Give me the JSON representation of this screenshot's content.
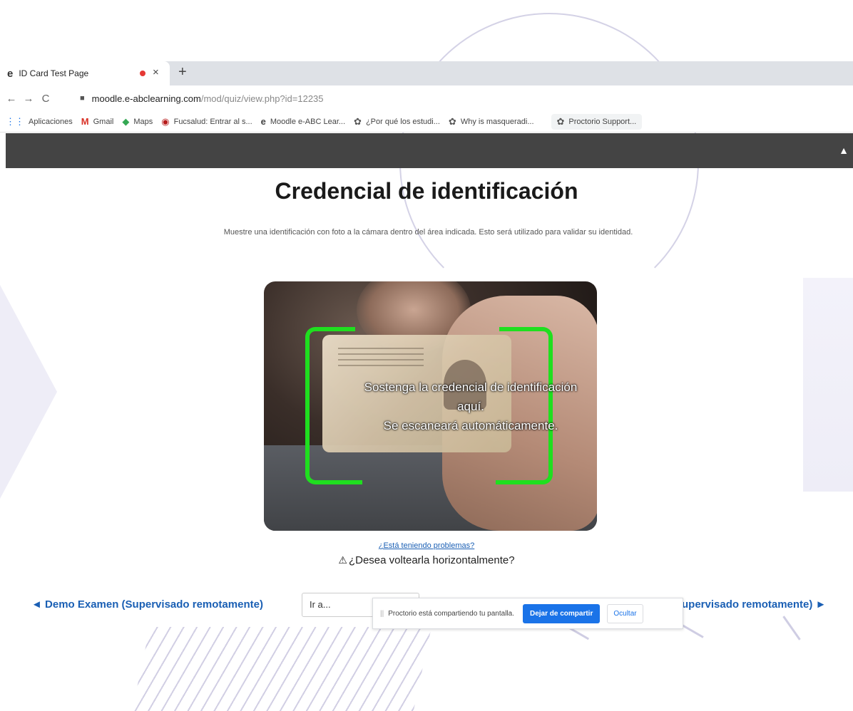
{
  "browser": {
    "tab_title": "ID Card Test Page",
    "tab_icon": "e",
    "close_glyph": "×",
    "new_tab_glyph": "+",
    "back_glyph": "←",
    "forward_glyph": "→",
    "reload_glyph": "C",
    "url_host": "moodle.e-abclearning.com",
    "url_path": "/mod/quiz/view.php?id=12235",
    "bookmarks": [
      {
        "icon": "apps-grid-icon",
        "glyph": "⋮⋮",
        "label": "Aplicaciones"
      },
      {
        "icon": "gmail-icon",
        "glyph": "M",
        "label": "Gmail"
      },
      {
        "icon": "maps-icon",
        "glyph": "◆",
        "label": "Maps"
      },
      {
        "icon": "fucsalud-icon",
        "glyph": "◉",
        "label": "Fucsalud: Entrar al s..."
      },
      {
        "icon": "moodle-icon",
        "glyph": "e",
        "label": "Moodle e-ABC Lear..."
      },
      {
        "icon": "proctorio-icon",
        "glyph": "✿",
        "label": "¿Por qué los estudi..."
      },
      {
        "icon": "proctorio-icon",
        "glyph": "✿",
        "label": "Why is masqueradi..."
      },
      {
        "icon": "proctorio-icon",
        "glyph": "✿",
        "label": "Proctorio Support..."
      }
    ]
  },
  "page": {
    "title": "Credencial de identificación",
    "instructions": "Muestre una identificación con foto a la cámara dentro del área indicada. Esto será utilizado para validar su identidad.",
    "camera_overlay_line1": "Sostenga la credencial de identificación",
    "camera_overlay_line2": "aquí.",
    "camera_overlay_line3": "Se escaneará automáticamente.",
    "trouble_link": "¿Está teniendo problemas?",
    "flip_warning_glyph": "⚠",
    "flip_question": "¿Desea voltearla horizontalmente?"
  },
  "quiz_nav": {
    "prev_label": "◄ Demo Examen (Supervisado remotamente)",
    "jump_label": "Ir a...",
    "next_label": "upervisado remotamente) ►"
  },
  "share_bar": {
    "grip": "||",
    "message": "Proctorio está compartiendo tu pantalla.",
    "stop_label": "Dejar de compartir",
    "hide_label": "Ocultar"
  },
  "colors": {
    "header_bg": "#444444",
    "link": "#1a5fb4",
    "scan_frame": "#1fdf1f",
    "primary_button": "#1a73e8"
  }
}
